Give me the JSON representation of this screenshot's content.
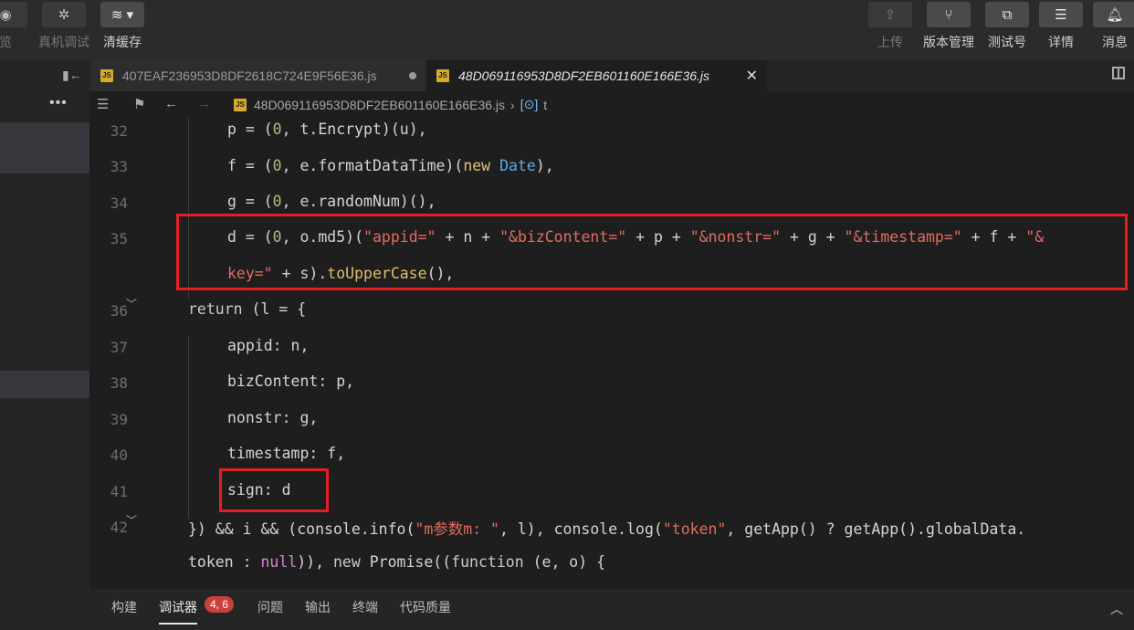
{
  "toolbar": {
    "left": [
      {
        "label": "览",
        "icon": "eye-icon"
      },
      {
        "label": "真机调试",
        "icon": "bug-icon"
      },
      {
        "label": "清缓存",
        "icon": "layers-icon"
      }
    ],
    "right": [
      {
        "label": "上传",
        "icon": "upload-icon"
      },
      {
        "label": "版本管理",
        "icon": "branch-icon"
      },
      {
        "label": "测试号",
        "icon": "external-link-icon"
      },
      {
        "label": "详情",
        "icon": "menu-icon"
      },
      {
        "label": "消息",
        "icon": "bell-icon"
      }
    ]
  },
  "tabs": [
    {
      "label": "407EAF236953D8DF2618C724E9F56E36.js"
    },
    {
      "label": "48D069116953D8DF2EB601160E166E36.js"
    }
  ],
  "breadcrumb": {
    "file": "48D069116953D8DF2EB601160E166E36.js",
    "symbol": "t"
  },
  "line_numbers": [
    "32",
    "33",
    "34",
    "35",
    "",
    "36",
    "37",
    "38",
    "39",
    "40",
    "41",
    "42",
    ""
  ],
  "code": {
    "l32": [
      "p = (",
      "0",
      ", t.",
      "Encrypt",
      ")(u),"
    ],
    "l33": [
      "f = (",
      "0",
      ", e.",
      "formatDataTime",
      ")(",
      "new",
      " ",
      "Date",
      "),"
    ],
    "l34": [
      "g = (",
      "0",
      ", e.",
      "randomNum",
      ")(),"
    ],
    "l35a": [
      "d = (",
      "0",
      ", o.",
      "md5",
      ")(",
      "\"appid=\"",
      " + n + ",
      "\"&bizContent=\"",
      " + p + ",
      "\"&nonstr=\"",
      " + g + ",
      "\"&timestamp=\"",
      " + f + ",
      "\"&"
    ],
    "l35b": [
      "key=\"",
      " + s).",
      "toUpperCase",
      "(),"
    ],
    "l36": [
      "return",
      " (l = {"
    ],
    "l37": "appid: n,",
    "l38": "bizContent: p,",
    "l39": "nonstr: g,",
    "l40": "timestamp: f,",
    "l41": "sign: d",
    "l42a": [
      "}) && i && (",
      "console",
      ".",
      "info",
      "(",
      "\"m参数m: \"",
      ", l), ",
      "console",
      ".",
      "log",
      "(",
      "\"token\"",
      ", ",
      "getApp",
      "() ? ",
      "getApp",
      "().globalData."
    ],
    "l42b": [
      "token : ",
      "null",
      ")), ",
      "new",
      " ",
      "Promise",
      "((",
      "function",
      " (e, o) {"
    ]
  },
  "bottom": {
    "tabs": [
      "构建",
      "调试器",
      "问题",
      "输出",
      "终端",
      "代码质量"
    ],
    "badge": "4, 6"
  }
}
